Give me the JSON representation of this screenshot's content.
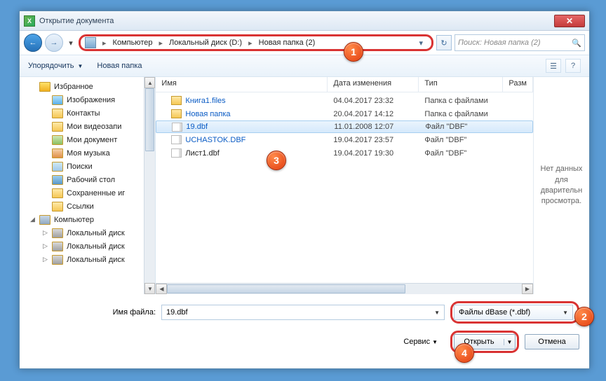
{
  "title": "Открытие документа",
  "breadcrumb": {
    "items": [
      "Компьютер",
      "Локальный диск (D:)",
      "Новая папка (2)"
    ]
  },
  "search_placeholder": "Поиск: Новая папка (2)",
  "toolbar": {
    "organize": "Упорядочить",
    "newfolder": "Новая папка"
  },
  "sidebar": {
    "items": [
      {
        "label": "Избранное",
        "cls": "star",
        "ind": 0,
        "exp": ""
      },
      {
        "label": "Изображения",
        "cls": "pic",
        "ind": 1,
        "exp": ""
      },
      {
        "label": "Контакты",
        "cls": "folder",
        "ind": 1,
        "exp": ""
      },
      {
        "label": "Мои видеозапи",
        "cls": "folder",
        "ind": 1,
        "exp": ""
      },
      {
        "label": "Мои документ",
        "cls": "doc",
        "ind": 1,
        "exp": ""
      },
      {
        "label": "Моя музыка",
        "cls": "mus",
        "ind": 1,
        "exp": ""
      },
      {
        "label": "Поиски",
        "cls": "srch",
        "ind": 1,
        "exp": ""
      },
      {
        "label": "Рабочий стол",
        "cls": "desk",
        "ind": 1,
        "exp": ""
      },
      {
        "label": "Сохраненные иг",
        "cls": "folder",
        "ind": 1,
        "exp": ""
      },
      {
        "label": "Ссылки",
        "cls": "folder",
        "ind": 1,
        "exp": ""
      },
      {
        "label": "Компьютер",
        "cls": "comp",
        "ind": 0,
        "exp": "◢"
      },
      {
        "label": "Локальный диск",
        "cls": "hdd",
        "ind": 1,
        "exp": "▷"
      },
      {
        "label": "Локальный диск",
        "cls": "hdd",
        "ind": 1,
        "exp": "▷"
      },
      {
        "label": "Локальный диск",
        "cls": "hdd",
        "ind": 1,
        "exp": "▷"
      }
    ]
  },
  "columns": {
    "name": "Имя",
    "date": "Дата изменения",
    "type": "Тип",
    "size": "Разм"
  },
  "files": [
    {
      "name": "Книга1.files",
      "date": "04.04.2017 23:32",
      "type": "Папка с файлами",
      "ico": "folder",
      "link": true,
      "sel": false
    },
    {
      "name": "Новая папка",
      "date": "20.04.2017 14:12",
      "type": "Папка с файлами",
      "ico": "folder",
      "link": true,
      "sel": false
    },
    {
      "name": "19.dbf",
      "date": "11.01.2008 12:07",
      "type": "Файл \"DBF\"",
      "ico": "file",
      "link": true,
      "sel": true
    },
    {
      "name": "UCHASTOK.DBF",
      "date": "19.04.2017 23:57",
      "type": "Файл \"DBF\"",
      "ico": "file",
      "link": true,
      "sel": false
    },
    {
      "name": "Лист1.dbf",
      "date": "19.04.2017 19:30",
      "type": "Файл \"DBF\"",
      "ico": "file",
      "link": false,
      "sel": false
    }
  ],
  "preview_text": "Нет данных для дварительн просмотра.",
  "footer": {
    "filename_label": "Имя файла:",
    "filename_value": "19.dbf",
    "filter_value": "Файлы dBase (*.dbf)",
    "service": "Сервис",
    "open": "Открыть",
    "cancel": "Отмена"
  },
  "callouts": {
    "c1": "1",
    "c2": "2",
    "c3": "3",
    "c4": "4"
  }
}
